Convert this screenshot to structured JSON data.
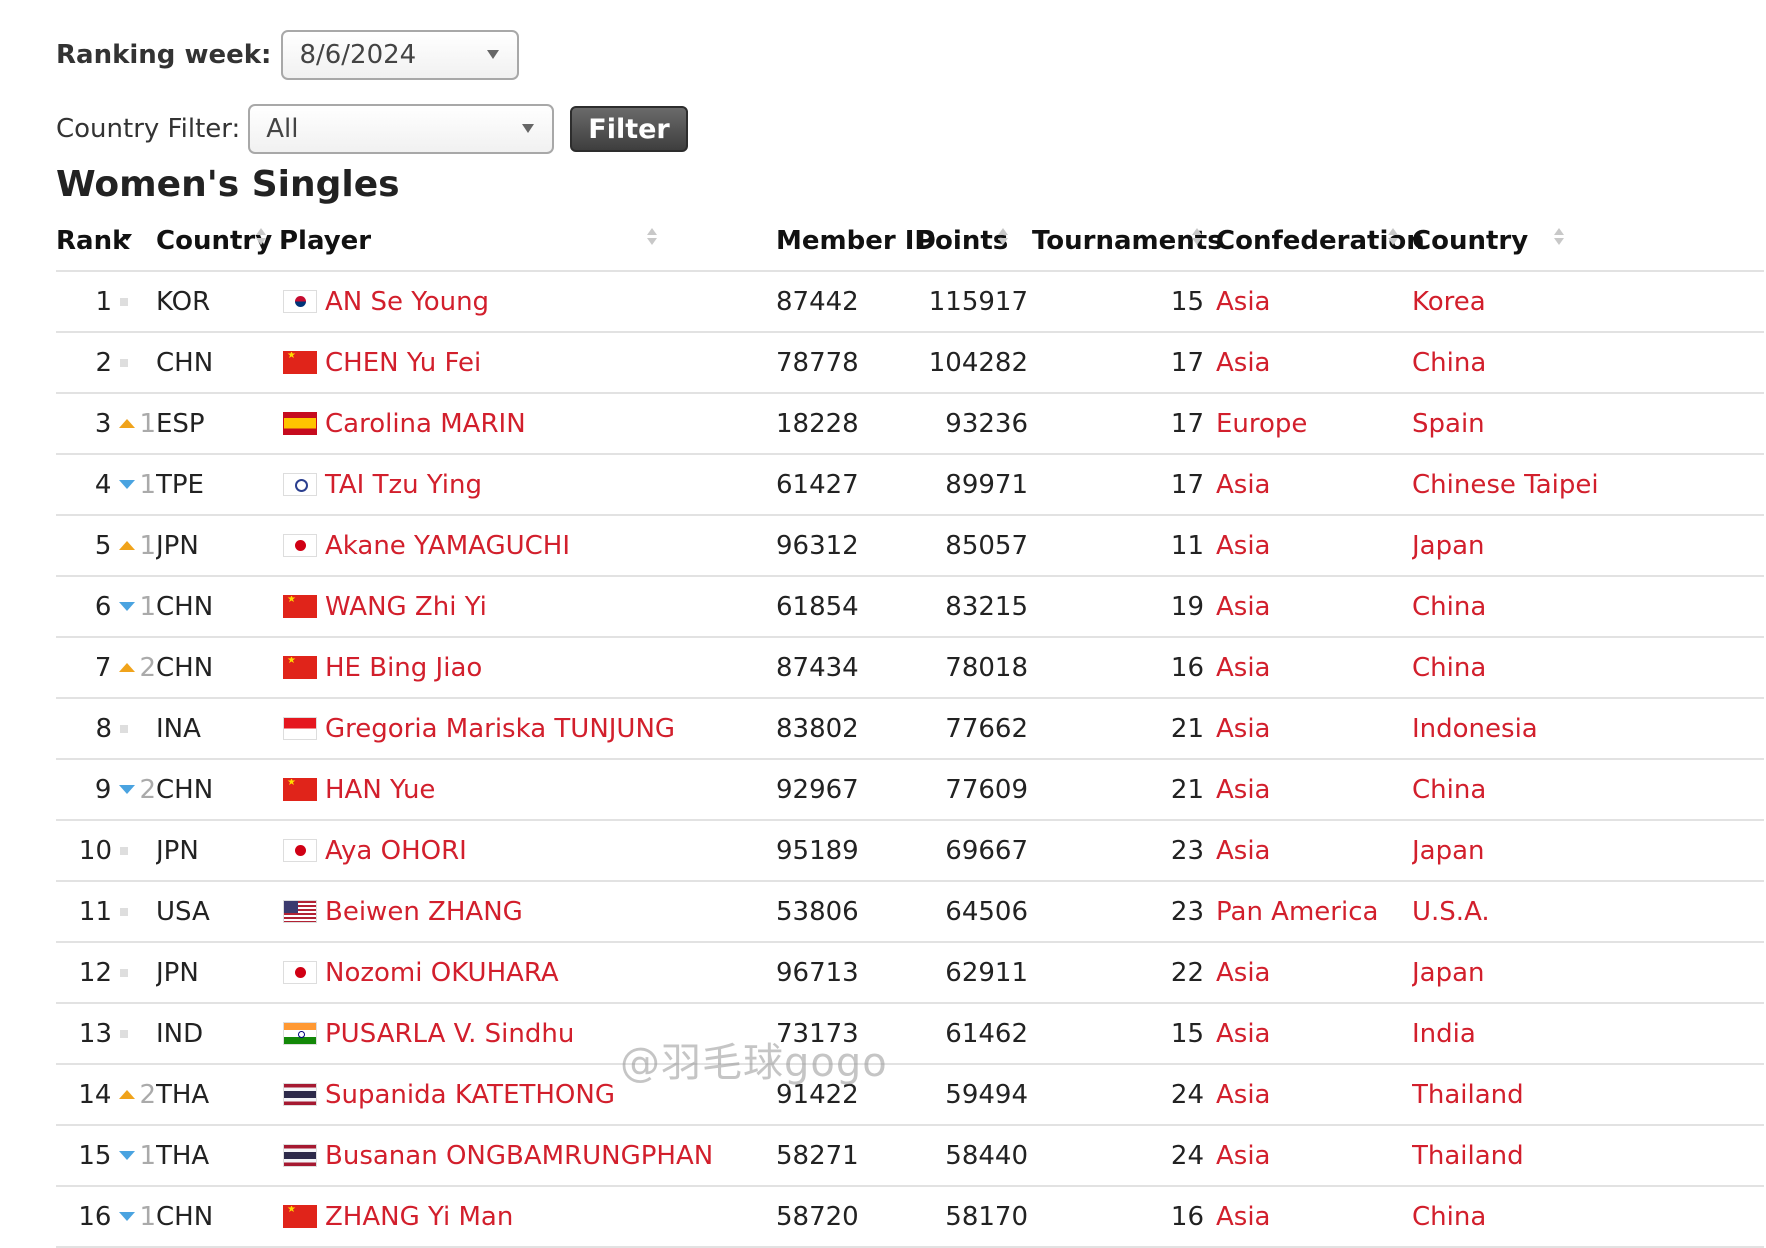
{
  "filters": {
    "ranking_week_label": "Ranking week:",
    "ranking_week_value": "8/6/2024",
    "country_filter_label": "Country Filter:",
    "country_filter_value": "All",
    "filter_button": "Filter"
  },
  "title": "Women's Singles",
  "columns": {
    "rank": "Rank",
    "country": "Country",
    "player": "Player",
    "member_id": "Member ID",
    "points": "Points",
    "tournaments": "Tournaments",
    "confederation": "Confederation",
    "country_name": "Country"
  },
  "rows": [
    {
      "rank": "1",
      "move": "same",
      "move_n": "",
      "code": "KOR",
      "flag": "kr",
      "player": "AN Se Young",
      "member_id": "87442",
      "points": "115917",
      "tournaments": "15",
      "confederation": "Asia",
      "country": "Korea"
    },
    {
      "rank": "2",
      "move": "same",
      "move_n": "",
      "code": "CHN",
      "flag": "cn",
      "player": "CHEN Yu Fei",
      "member_id": "78778",
      "points": "104282",
      "tournaments": "17",
      "confederation": "Asia",
      "country": "China"
    },
    {
      "rank": "3",
      "move": "up",
      "move_n": "1",
      "code": "ESP",
      "flag": "es",
      "player": "Carolina MARIN",
      "member_id": "18228",
      "points": "93236",
      "tournaments": "17",
      "confederation": "Europe",
      "country": "Spain"
    },
    {
      "rank": "4",
      "move": "down",
      "move_n": "1",
      "code": "TPE",
      "flag": "tpe",
      "player": "TAI Tzu Ying",
      "member_id": "61427",
      "points": "89971",
      "tournaments": "17",
      "confederation": "Asia",
      "country": "Chinese Taipei"
    },
    {
      "rank": "5",
      "move": "up",
      "move_n": "1",
      "code": "JPN",
      "flag": "jp",
      "player": "Akane YAMAGUCHI",
      "member_id": "96312",
      "points": "85057",
      "tournaments": "11",
      "confederation": "Asia",
      "country": "Japan"
    },
    {
      "rank": "6",
      "move": "down",
      "move_n": "1",
      "code": "CHN",
      "flag": "cn",
      "player": "WANG Zhi Yi",
      "member_id": "61854",
      "points": "83215",
      "tournaments": "19",
      "confederation": "Asia",
      "country": "China"
    },
    {
      "rank": "7",
      "move": "up",
      "move_n": "2",
      "code": "CHN",
      "flag": "cn",
      "player": "HE Bing Jiao",
      "member_id": "87434",
      "points": "78018",
      "tournaments": "16",
      "confederation": "Asia",
      "country": "China"
    },
    {
      "rank": "8",
      "move": "same",
      "move_n": "",
      "code": "INA",
      "flag": "id",
      "player": "Gregoria Mariska TUNJUNG",
      "member_id": "83802",
      "points": "77662",
      "tournaments": "21",
      "confederation": "Asia",
      "country": "Indonesia"
    },
    {
      "rank": "9",
      "move": "down",
      "move_n": "2",
      "code": "CHN",
      "flag": "cn",
      "player": "HAN Yue",
      "member_id": "92967",
      "points": "77609",
      "tournaments": "21",
      "confederation": "Asia",
      "country": "China"
    },
    {
      "rank": "10",
      "move": "same",
      "move_n": "",
      "code": "JPN",
      "flag": "jp",
      "player": "Aya OHORI",
      "member_id": "95189",
      "points": "69667",
      "tournaments": "23",
      "confederation": "Asia",
      "country": "Japan"
    },
    {
      "rank": "11",
      "move": "same",
      "move_n": "",
      "code": "USA",
      "flag": "us",
      "player": "Beiwen ZHANG",
      "member_id": "53806",
      "points": "64506",
      "tournaments": "23",
      "confederation": "Pan America",
      "country": "U.S.A."
    },
    {
      "rank": "12",
      "move": "same",
      "move_n": "",
      "code": "JPN",
      "flag": "jp",
      "player": "Nozomi OKUHARA",
      "member_id": "96713",
      "points": "62911",
      "tournaments": "22",
      "confederation": "Asia",
      "country": "Japan"
    },
    {
      "rank": "13",
      "move": "same",
      "move_n": "",
      "code": "IND",
      "flag": "in",
      "player": "PUSARLA V. Sindhu",
      "member_id": "73173",
      "points": "61462",
      "tournaments": "15",
      "confederation": "Asia",
      "country": "India"
    },
    {
      "rank": "14",
      "move": "up",
      "move_n": "2",
      "code": "THA",
      "flag": "th",
      "player": "Supanida KATETHONG",
      "member_id": "91422",
      "points": "59494",
      "tournaments": "24",
      "confederation": "Asia",
      "country": "Thailand"
    },
    {
      "rank": "15",
      "move": "down",
      "move_n": "1",
      "code": "THA",
      "flag": "th",
      "player": "Busanan ONGBAMRUNGPHAN",
      "member_id": "58271",
      "points": "58440",
      "tournaments": "24",
      "confederation": "Asia",
      "country": "Thailand"
    },
    {
      "rank": "16",
      "move": "down",
      "move_n": "1",
      "code": "CHN",
      "flag": "cn",
      "player": "ZHANG Yi Man",
      "member_id": "58720",
      "points": "58170",
      "tournaments": "16",
      "confederation": "Asia",
      "country": "China"
    }
  ],
  "watermark": "@羽毛球gogo",
  "colors": {
    "link": "#d21f2c",
    "up": "#f0a31b",
    "down": "#4aa3e0"
  }
}
